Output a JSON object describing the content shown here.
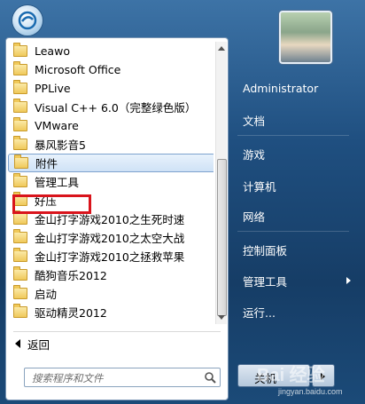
{
  "programs": [
    {
      "label": "Leawo"
    },
    {
      "label": "Microsoft Office"
    },
    {
      "label": "PPLive"
    },
    {
      "label": "Visual C++ 6.0（完整绿色版）"
    },
    {
      "label": "VMware"
    },
    {
      "label": "暴风影音5"
    },
    {
      "label": "附件"
    },
    {
      "label": "管理工具"
    },
    {
      "label": "好压"
    },
    {
      "label": "金山打字游戏2010之生死时速"
    },
    {
      "label": "金山打字游戏2010之太空大战"
    },
    {
      "label": "金山打字游戏2010之拯救苹果"
    },
    {
      "label": "酷狗音乐2012"
    },
    {
      "label": "启动"
    },
    {
      "label": "驱动精灵2012"
    }
  ],
  "selected_index": 6,
  "back_label": "返回",
  "search": {
    "placeholder": "搜索程序和文件"
  },
  "right": {
    "user": "Administrator",
    "documents": "文档",
    "games": "游戏",
    "computer": "计算机",
    "network": "网络",
    "control_panel": "控制面板",
    "admin_tools": "管理工具",
    "run": "运行..."
  },
  "shutdown_label": "关机",
  "watermark": {
    "logo": "Bai 经验",
    "site": "jingyan.baidu.com"
  },
  "colors": {
    "highlight": "#d9141c",
    "accent": "#1f4f80"
  }
}
